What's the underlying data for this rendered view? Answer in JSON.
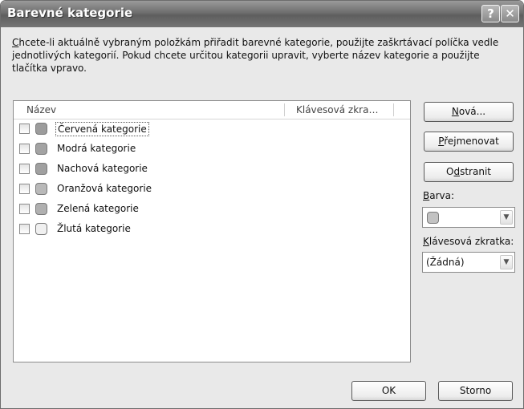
{
  "window": {
    "title": "Barevné kategorie",
    "help_glyph": "?",
    "close_glyph": "✕"
  },
  "description": {
    "access_key": "C",
    "text_rest": "hcete-li aktuálně vybraným položkám přiřadit barevné kategorie, použijte zaškrtávací políčka vedle jednotlivých kategorií. Pokud chcete určitou kategorii upravit, vyberte název kategorie a použijte tlačítka vpravo."
  },
  "list": {
    "columns": [
      "Název",
      "Klávesová zkra…"
    ],
    "items": [
      {
        "label": "Červená kategorie",
        "color": "#9c9c9c",
        "checked": false,
        "selected": true
      },
      {
        "label": "Modrá kategorie",
        "color": "#a3a3a3",
        "checked": false,
        "selected": false
      },
      {
        "label": "Nachová kategorie",
        "color": "#a0a0a0",
        "checked": false,
        "selected": false
      },
      {
        "label": "Oranžová kategorie",
        "color": "#b9b9b9",
        "checked": false,
        "selected": false
      },
      {
        "label": "Zelená kategorie",
        "color": "#b0b0b0",
        "checked": false,
        "selected": false
      },
      {
        "label": "Žlutá kategorie",
        "color": "#f0f0f0",
        "checked": false,
        "selected": false
      }
    ]
  },
  "buttons": {
    "new": {
      "pre": "",
      "key": "N",
      "post": "ová..."
    },
    "rename": {
      "pre": "",
      "key": "P",
      "post": "řejmenovat"
    },
    "delete": {
      "pre": "O",
      "key": "d",
      "post": "stranit"
    },
    "ok": "OK",
    "cancel": "Storno"
  },
  "color_field": {
    "pre": "",
    "key": "B",
    "post": "arva:",
    "swatch": "#c2c2c2"
  },
  "shortcut_field": {
    "pre": "",
    "key": "K",
    "post": "lávesová zkratka:",
    "value": "(Žádná)"
  }
}
